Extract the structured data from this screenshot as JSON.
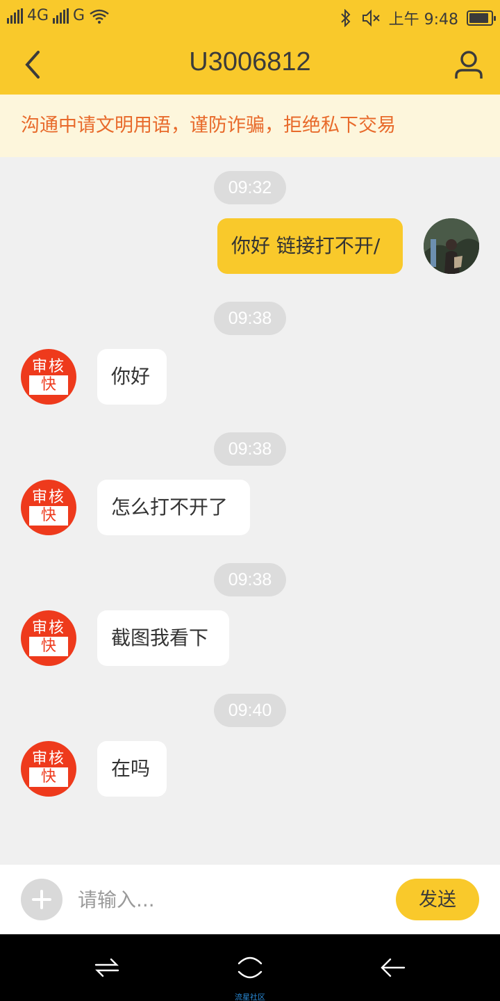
{
  "status_bar": {
    "network_1": "4G",
    "network_2": "G",
    "time": "上午 9:48",
    "battery_percent": 90
  },
  "header": {
    "title": "U3006812"
  },
  "notice": {
    "text": "沟通中请文明用语，谨防诈骗，拒绝私下交易"
  },
  "messages": [
    {
      "time": "09:32",
      "sender": "me",
      "text": "你好 链接打不开/"
    },
    {
      "time": "09:38",
      "sender": "other",
      "text": "你好"
    },
    {
      "time": "09:38",
      "sender": "other",
      "text": "怎么打不开了"
    },
    {
      "time": "09:38",
      "sender": "other",
      "text": "截图我看下"
    },
    {
      "time": "09:40",
      "sender": "other",
      "text": "在吗"
    }
  ],
  "other_avatar": {
    "line1": "审核",
    "line2": "快"
  },
  "input_bar": {
    "placeholder": "请输入...",
    "send_label": "发送"
  },
  "nav_bar": {
    "watermark": "流星社区"
  },
  "colors": {
    "accent": "#f9c92b",
    "notice_text": "#e86a2b",
    "avatar_red": "#ee3a1c"
  }
}
